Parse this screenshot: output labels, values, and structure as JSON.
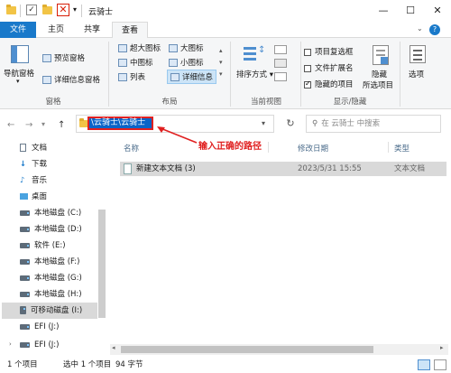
{
  "window": {
    "title": "云骑士",
    "minimize": "—",
    "maximize": "☐",
    "close": "✕",
    "quick_access_dropdown": "▾"
  },
  "tabs": [
    "文件",
    "主页",
    "共享",
    "查看"
  ],
  "help": "?",
  "ribbon": {
    "pane": {
      "nav_pane": "导航窗格",
      "preview_pane": "预览窗格",
      "details_pane": "详细信息窗格",
      "group": "窗格"
    },
    "layout": {
      "xl_icons": "超大图标",
      "large_icons": "大图标",
      "medium_icons": "中图标",
      "small_icons": "小图标",
      "list": "列表",
      "details": "详细信息",
      "group": "布局"
    },
    "current_view": {
      "sort_by": "排序方式",
      "group": "当前视图"
    },
    "show_hide": {
      "item_checkboxes": "项目复选框",
      "file_extensions": "文件扩展名",
      "hidden_items": "隐藏的项目",
      "hide": "隐藏",
      "selected_items": "所选项目",
      "group": "显示/隐藏",
      "hidden_items_checked": true
    },
    "options": "选项"
  },
  "address": {
    "path": "\\云骑士\\云骑士",
    "back": "←",
    "forward": "→",
    "dropdown": "▾",
    "up": "↑",
    "refresh": "↻"
  },
  "search": {
    "placeholder": "在 云骑士 中搜索"
  },
  "annotation": "输入正确的路径",
  "sidebar": [
    {
      "label": "文档",
      "icon": "document-icon"
    },
    {
      "label": "下载",
      "icon": "download-icon"
    },
    {
      "label": "音乐",
      "icon": "music-icon"
    },
    {
      "label": "桌面",
      "icon": "desktop-icon"
    },
    {
      "label": "本地磁盘 (C:)",
      "icon": "drive-icon"
    },
    {
      "label": "本地磁盘 (D:)",
      "icon": "drive-icon"
    },
    {
      "label": "软件 (E:)",
      "icon": "drive-icon"
    },
    {
      "label": "本地磁盘 (F:)",
      "icon": "drive-icon"
    },
    {
      "label": "本地磁盘 (G:)",
      "icon": "drive-icon"
    },
    {
      "label": "本地磁盘 (H:)",
      "icon": "drive-icon"
    },
    {
      "label": "可移动磁盘 (I:)",
      "icon": "usb-drive-icon"
    },
    {
      "label": "EFI (J:)",
      "icon": "drive-icon"
    },
    {
      "label": "EFI (J:)",
      "icon": "drive-icon"
    }
  ],
  "columns": {
    "name": "名称",
    "date": "修改日期",
    "type": "类型"
  },
  "files": [
    {
      "name": "新建文本文档 (3)",
      "date": "2023/5/31 15:55",
      "type": "文本文档"
    }
  ],
  "status": {
    "count": "1 个项目",
    "selected": "选中 1 个项目",
    "size": "94 字节"
  }
}
